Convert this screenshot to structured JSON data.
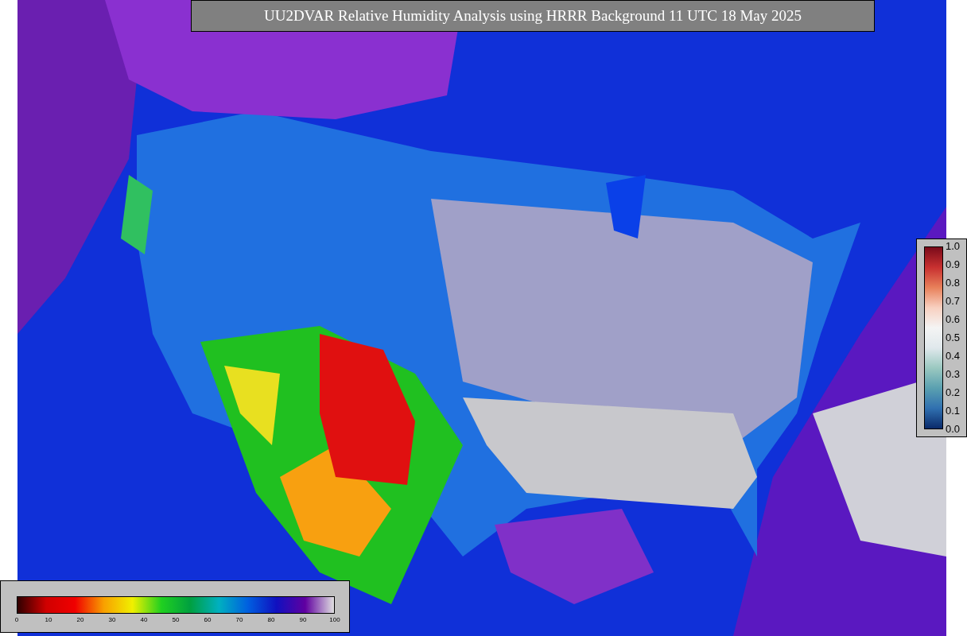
{
  "title": "UU2DVAR Relative Humidity Analysis using HRRR Background 11 UTC 18 May 2025",
  "observation_colorbar": {
    "ticks": [
      "1.0",
      "0.9",
      "0.8",
      "0.7",
      "0.6",
      "0.5",
      "0.4",
      "0.3",
      "0.2",
      "0.1",
      "0.0"
    ]
  },
  "analysis_colorbar": {
    "ticks": [
      "0",
      "10",
      "20",
      "30",
      "40",
      "50",
      "60",
      "70",
      "80",
      "90",
      "100"
    ]
  }
}
